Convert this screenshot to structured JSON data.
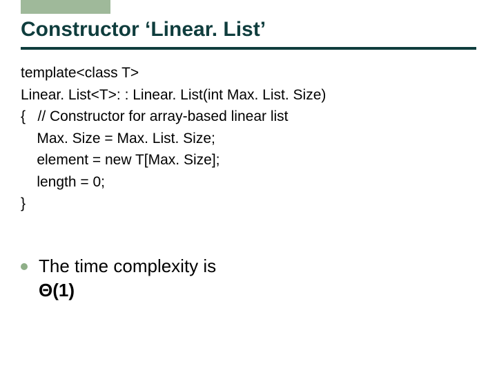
{
  "title": "Constructor ‘Linear. List’",
  "code": {
    "l1": "template<class T>",
    "l2": "Linear. List<T>: : Linear. List(int Max. List. Size)",
    "l3": "{   // Constructor for array-based linear list",
    "l4": "    Max. Size = Max. List. Size;",
    "l5": "    element = new T[Max. Size];",
    "l6": "    length = 0;",
    "l7": "}"
  },
  "bullet": {
    "line1": "The time complexity is",
    "line2": "Θ(1)"
  }
}
